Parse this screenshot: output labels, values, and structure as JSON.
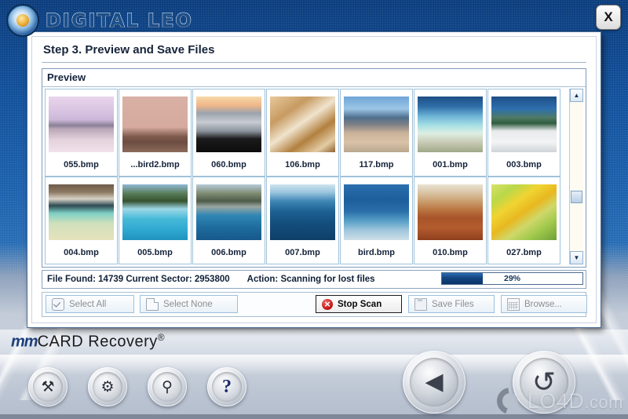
{
  "app": {
    "brand_prefix": "DIGITAL",
    "brand_suffix": "LEO",
    "logo_icon": "globe-lion-logo-icon",
    "close_label": "X",
    "product_name_mm": "mm",
    "product_name_rest": "CARD Recovery",
    "product_registered": "®"
  },
  "dialog": {
    "step_title": "Step 3. Preview and Save Files",
    "preview_legend": "Preview"
  },
  "preview": {
    "rows": [
      [
        {
          "label": "055.bmp",
          "thumb": "lake-sunset-purple"
        },
        {
          "label": "...bird2.bmp",
          "thumb": "birds-flock-pink"
        },
        {
          "label": "060.bmp",
          "thumb": "beach-dusk-orange"
        },
        {
          "label": "106.bmp",
          "thumb": "driftwood-brown"
        },
        {
          "label": "117.bmp",
          "thumb": "beach-mountains"
        },
        {
          "label": "001.bmp",
          "thumb": "palm-beach-tropical"
        },
        {
          "label": "003.bmp",
          "thumb": "white-sand-beach"
        }
      ],
      [
        {
          "label": "004.bmp",
          "thumb": "shore-sand-teal"
        },
        {
          "label": "005.bmp",
          "thumb": "island-turquoise"
        },
        {
          "label": "006.bmp",
          "thumb": "rocky-island-blue"
        },
        {
          "label": "007.bmp",
          "thumb": "deep-ocean-blue"
        },
        {
          "label": "bird.bmp",
          "thumb": "seagulls-sky"
        },
        {
          "label": "010.bmp",
          "thumb": "desert-clouds-orange"
        },
        {
          "label": "027.bmp",
          "thumb": "coral-clownfish"
        }
      ]
    ],
    "scrollbar": {
      "up_icon": "chevron-up-icon",
      "down_icon": "chevron-down-icon"
    }
  },
  "status": {
    "files_and_sector": "File Found: 14739 Current Sector: 2953800",
    "action": "Action:  Scanning for lost files",
    "progress_percent_label": "29%",
    "progress_percent_value": 29
  },
  "buttons": {
    "select_all": {
      "label": "Select All",
      "icon": "checkbox-check-icon",
      "enabled": false
    },
    "select_none": {
      "label": "Select None",
      "icon": "blank-page-icon",
      "enabled": false
    },
    "stop_scan": {
      "label": "Stop Scan",
      "icon": "stop-red-circle-icon",
      "enabled": true
    },
    "save_files": {
      "label": "Save Files",
      "icon": "floppy-disk-icon",
      "enabled": false
    },
    "browse": {
      "label": "Browse...",
      "icon": "grid-folder-icon",
      "enabled": false
    }
  },
  "toolbar": {
    "tool_1": {
      "icon": "wrench-tool-icon",
      "glyph": "⚒"
    },
    "tool_2": {
      "icon": "gear-settings-icon",
      "glyph": "⚙"
    },
    "tool_3": {
      "icon": "magnifier-search-icon",
      "glyph": "⚲"
    },
    "tool_4": {
      "icon": "help-question-icon",
      "glyph": "?"
    }
  },
  "navigation": {
    "back": {
      "icon": "back-triangle-icon",
      "glyph": "◀"
    },
    "restart": {
      "icon": "restart-circular-arrow-icon",
      "glyph": "↺"
    }
  },
  "watermark": {
    "text": "LO4D",
    "suffix": ".com",
    "logo_icon": "lo4d-circular-arrow-icon"
  },
  "colors": {
    "brand_blue": "#1a4f8c",
    "progress_blue": "#13447f",
    "stop_red": "#c41515",
    "panel_border": "#7f9bbb"
  }
}
